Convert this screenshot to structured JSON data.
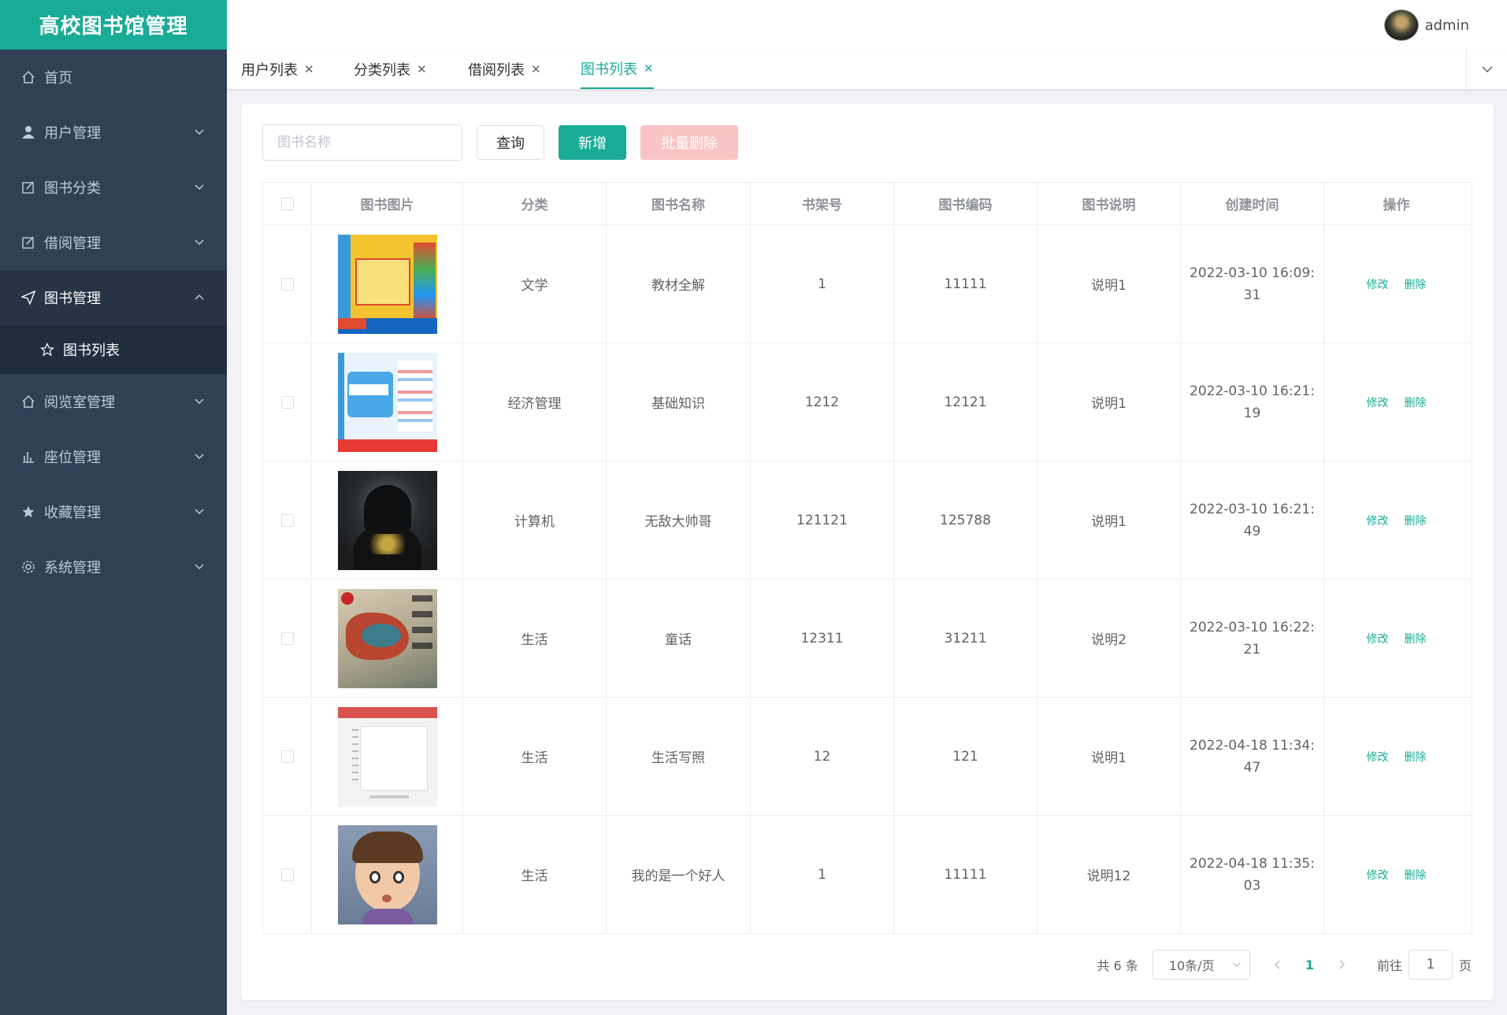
{
  "app": {
    "title": "高校图书馆管理"
  },
  "header": {
    "user_name": "admin"
  },
  "sidebar": {
    "items": [
      {
        "label": "首页",
        "icon": "home-icon"
      },
      {
        "label": "用户管理",
        "icon": "user-icon"
      },
      {
        "label": "图书分类",
        "icon": "edit-icon"
      },
      {
        "label": "借阅管理",
        "icon": "edit-icon"
      },
      {
        "label": "图书管理",
        "icon": "send-icon"
      },
      {
        "label": "阅览室管理",
        "icon": "home-icon"
      },
      {
        "label": "座位管理",
        "icon": "chart-icon"
      },
      {
        "label": "收藏管理",
        "icon": "star-icon"
      },
      {
        "label": "系统管理",
        "icon": "gear-icon"
      }
    ],
    "sub_item": {
      "label": "图书列表",
      "icon": "star-outline-icon"
    }
  },
  "tabs": [
    {
      "label": "用户列表"
    },
    {
      "label": "分类列表"
    },
    {
      "label": "借阅列表"
    },
    {
      "label": "图书列表"
    }
  ],
  "toolbar": {
    "search_placeholder": "图书名称",
    "query_label": "查询",
    "add_label": "新增",
    "batch_delete_label": "批量删除"
  },
  "table": {
    "headers": [
      "图书图片",
      "分类",
      "图书名称",
      "书架号",
      "图书编码",
      "图书说明",
      "创建时间",
      "操作"
    ],
    "rows": [
      {
        "category": "文学",
        "name": "教材全解",
        "shelf": "1",
        "code": "11111",
        "desc": "说明1",
        "created": "2022-03-10 16:09:31"
      },
      {
        "category": "经济管理",
        "name": "基础知识",
        "shelf": "1212",
        "code": "12121",
        "desc": "说明1",
        "created": "2022-03-10 16:21:19"
      },
      {
        "category": "计算机",
        "name": "无敌大帅哥",
        "shelf": "121121",
        "code": "125788",
        "desc": "说明1",
        "created": "2022-03-10 16:21:49"
      },
      {
        "category": "生活",
        "name": "童话",
        "shelf": "12311",
        "code": "31211",
        "desc": "说明2",
        "created": "2022-03-10 16:22:21"
      },
      {
        "category": "生活",
        "name": "生活写照",
        "shelf": "12",
        "code": "121",
        "desc": "说明1",
        "created": "2022-04-18 11:34:47"
      },
      {
        "category": "生活",
        "name": "我的是一个好人",
        "shelf": "1",
        "code": "11111",
        "desc": "说明12",
        "created": "2022-04-18 11:35:03"
      }
    ],
    "edit_label": "修改",
    "delete_label": "删除"
  },
  "pagination": {
    "total_text": "共 6 条",
    "page_size": "10条/页",
    "current_page": "1",
    "goto_label": "前往",
    "goto_value": "1",
    "page_suffix": "页"
  },
  "colors": {
    "primary": "#1aab96",
    "sidebar_bg": "#304156",
    "danger_light": "#fbc4c4"
  }
}
